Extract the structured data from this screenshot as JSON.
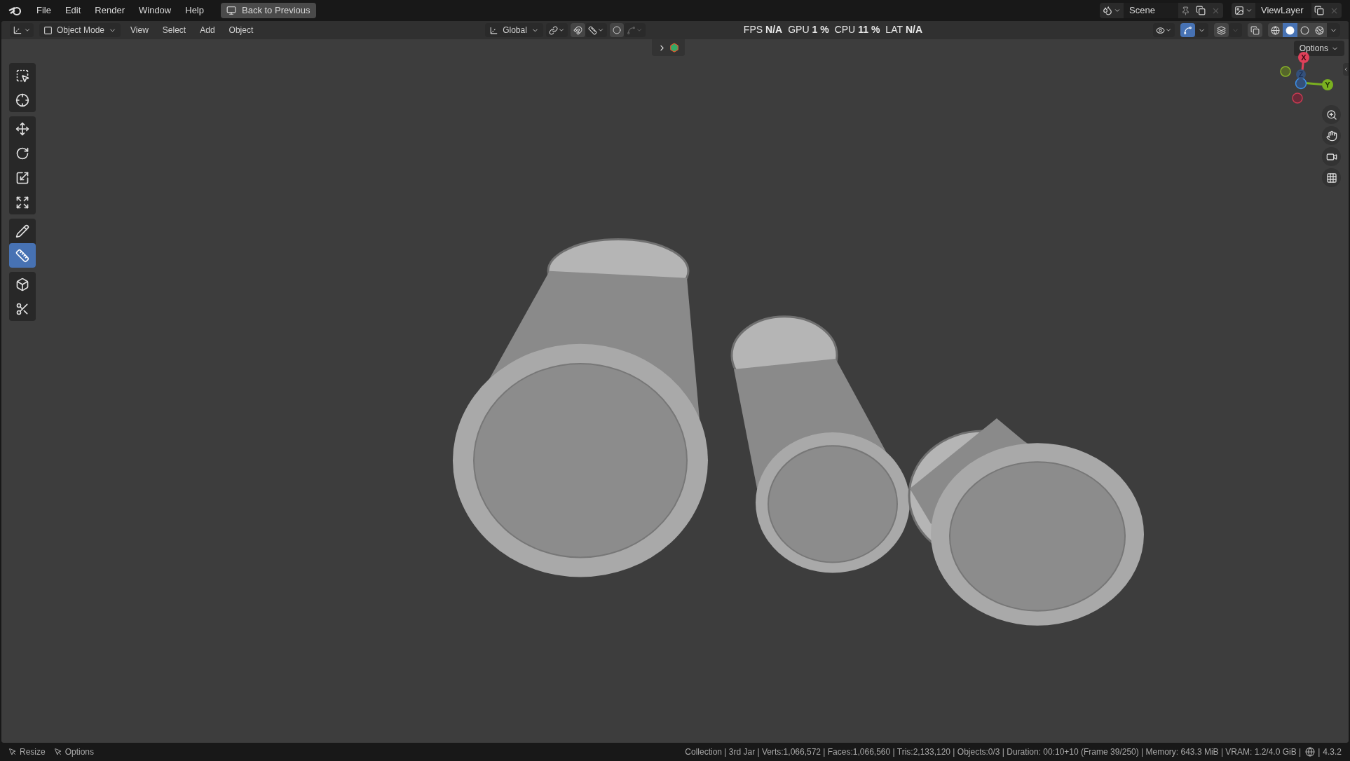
{
  "menu": [
    "File",
    "Edit",
    "Render",
    "Window",
    "Help"
  ],
  "back_button": "Back to Previous",
  "header": {
    "mode": "Object Mode",
    "menus": [
      "View",
      "Select",
      "Add",
      "Object"
    ],
    "orientation": "Global"
  },
  "stats": [
    {
      "label": "FPS",
      "value": "N/A"
    },
    {
      "label": "GPU",
      "value": "1 %"
    },
    {
      "label": "CPU",
      "value": "11 %"
    },
    {
      "label": "LAT",
      "value": "N/A"
    }
  ],
  "scene": "Scene",
  "view_layer": "ViewLayer",
  "shading": [
    {
      "kind": "wireframe",
      "selected": false
    },
    {
      "kind": "solid",
      "selected": true
    },
    {
      "kind": "material",
      "selected": false
    },
    {
      "kind": "rendered",
      "selected": false
    }
  ],
  "options": "Options",
  "tool_groups": [
    [
      {
        "kind": "select",
        "selected": false
      },
      {
        "kind": "cursor",
        "selected": false
      }
    ],
    [
      {
        "kind": "move",
        "selected": false
      },
      {
        "kind": "rotate",
        "selected": false
      },
      {
        "kind": "scale",
        "selected": false
      },
      {
        "kind": "transform",
        "selected": false
      }
    ],
    [
      {
        "kind": "annotate",
        "selected": false
      },
      {
        "kind": "measure",
        "selected": true
      }
    ],
    [
      {
        "kind": "add-cube",
        "selected": false
      },
      {
        "kind": "cut",
        "selected": false
      }
    ]
  ],
  "gizmo": {
    "x": "X",
    "y": "Y",
    "z": "Z"
  },
  "viewport": {
    "kind": "picture"
  },
  "status_left": [
    "Resize",
    "Options"
  ],
  "status": "Collection | 3rd Jar | Verts:1,066,572 | Faces:1,066,560 | Tris:2,133,120 | Objects:0/3 | Duration: 00:10+10 (Frame 39/250) | Memory: 643.3 MiB | VRAM: 1.2/4.0 GiB |",
  "separator": "|",
  "version": "4.3.2"
}
